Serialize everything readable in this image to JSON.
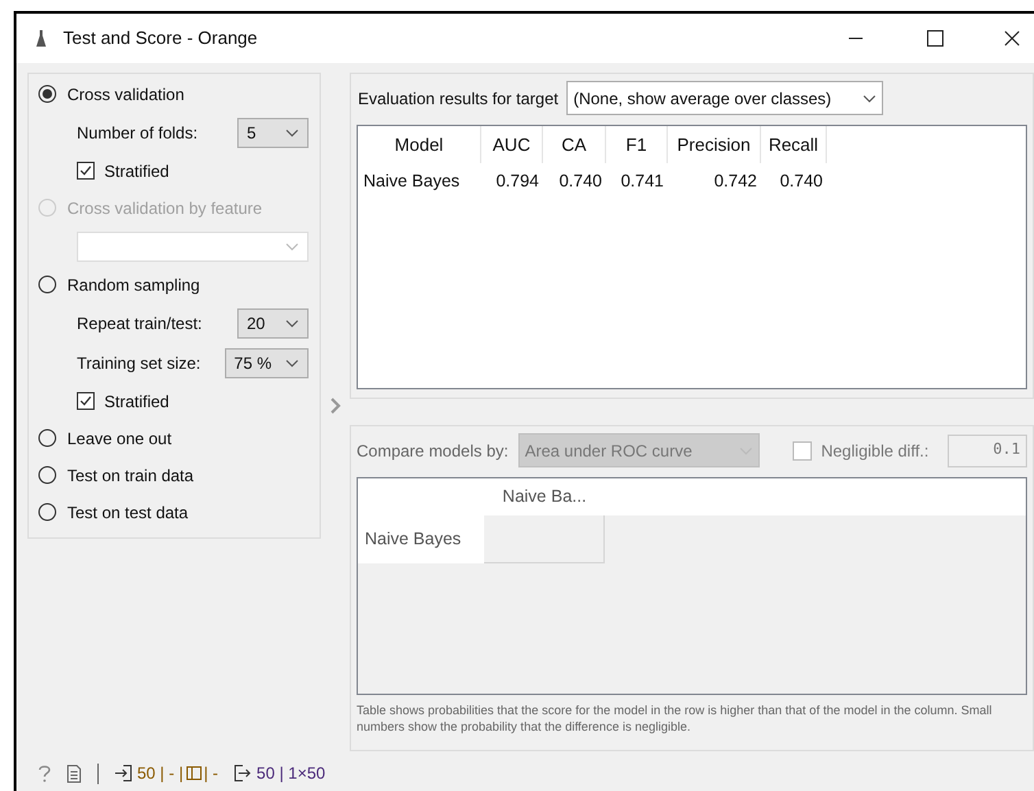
{
  "window": {
    "title": "Test and Score - Orange"
  },
  "sampling": [
    {
      "kind": "radio",
      "label": "Cross validation",
      "selected": true,
      "disabled": false,
      "children": [
        {
          "kind": "combo",
          "label": "Number of folds:",
          "value": "5"
        },
        {
          "kind": "checkbox",
          "label": "Stratified",
          "checked": true
        }
      ]
    },
    {
      "kind": "radio",
      "label": "Cross validation by feature",
      "selected": false,
      "disabled": true,
      "children": [
        {
          "kind": "combo"
        }
      ]
    },
    {
      "kind": "radio",
      "label": "Random sampling",
      "selected": false,
      "disabled": false,
      "children": [
        {
          "kind": "combo",
          "label": "Repeat train/test:",
          "value": "20"
        },
        {
          "kind": "combo",
          "label": "Training set size:",
          "value": "75 %"
        },
        {
          "kind": "checkbox",
          "label": "Stratified",
          "checked": true
        }
      ]
    },
    {
      "kind": "radio",
      "label": "Leave one out",
      "selected": false,
      "disabled": false
    },
    {
      "kind": "radio",
      "label": "Test on train data",
      "selected": false,
      "disabled": false
    },
    {
      "kind": "radio",
      "label": "Test on test data",
      "selected": false,
      "disabled": false
    }
  ],
  "evaluation": {
    "target_label": "Evaluation results for target",
    "target_value": "(None, show average over classes)",
    "table": {
      "columns": [
        "Model",
        "AUC",
        "CA",
        "F1",
        "Precision",
        "Recall"
      ],
      "rows": [
        [
          "Naive Bayes",
          "0.794",
          "0.740",
          "0.741",
          "0.742",
          "0.740"
        ]
      ]
    }
  },
  "comparison": {
    "label": "Compare models by:",
    "value": "Area under ROC curve",
    "disabled": true,
    "negligible": {
      "label": "Negligible diff.:",
      "checked": false,
      "value": "0.1"
    },
    "columns": [
      "Naive Ba..."
    ],
    "rows": [
      "Naive Bayes"
    ],
    "note": "Table shows probabilities that the score for the model in the row is higher than that of the model in the column. Small numbers show the probability that the difference is negligible."
  },
  "status_bar": {
    "input": "50 | - |",
    "input_end": "| -",
    "output": "50 | 1×50"
  }
}
